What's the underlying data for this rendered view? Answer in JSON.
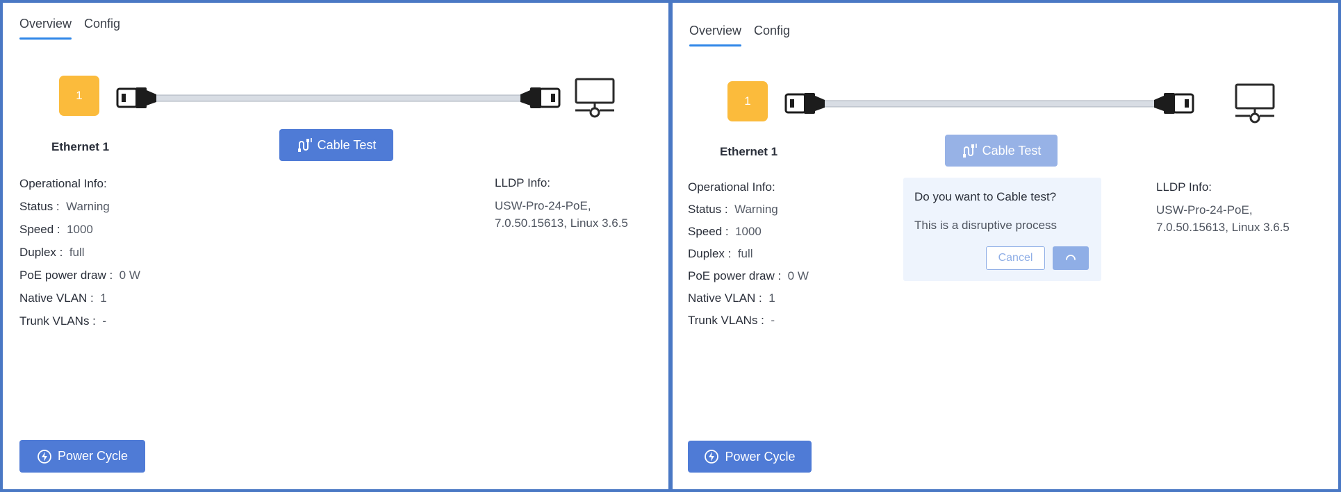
{
  "tabs": {
    "overview": "Overview",
    "config": "Config"
  },
  "port": {
    "number": "1",
    "name": "Ethernet 1"
  },
  "buttons": {
    "cable_test": "Cable Test",
    "power_cycle": "Power Cycle"
  },
  "operational": {
    "heading": "Operational Info:",
    "rows": [
      {
        "label": "Status :",
        "value": "Warning"
      },
      {
        "label": "Speed :",
        "value": "1000"
      },
      {
        "label": "Duplex :",
        "value": "full"
      },
      {
        "label": "PoE power draw :",
        "value": "0 W"
      },
      {
        "label": "Native VLAN :",
        "value": "1"
      },
      {
        "label": "Trunk VLANs :",
        "value": "-"
      }
    ]
  },
  "lldp": {
    "heading": "LLDP Info:",
    "line1": "USW-Pro-24-PoE,",
    "line2": "7.0.50.15613, Linux 3.6.5"
  },
  "confirm_dialog": {
    "question": "Do you want to Cable test?",
    "description": "This is a disruptive process",
    "cancel": "Cancel"
  },
  "colors": {
    "accent": "#4f7bd6",
    "accent_disabled": "#97b2e6",
    "port_badge": "#fbbb3c",
    "tab_underline": "#2f86e8",
    "frame": "#4a78c4"
  },
  "icons": {
    "cable_test": "cable-test-icon",
    "power_cycle": "power-cycle-icon",
    "device": "monitor-network-icon",
    "spinner": "loading-spinner-icon"
  }
}
